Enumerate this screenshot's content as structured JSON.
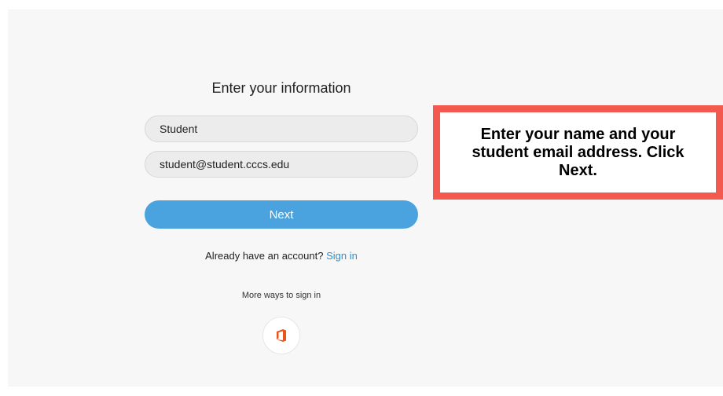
{
  "form": {
    "heading": "Enter your information",
    "name_value": "Student",
    "email_value": "student@student.cccs.edu",
    "next_label": "Next",
    "account_prompt": "Already have an account?",
    "signin_label": "Sign in",
    "more_ways_label": "More ways to sign in"
  },
  "callout": {
    "text": "Enter your name and your student email address. Click Next."
  },
  "icons": {
    "office": "office-icon"
  },
  "colors": {
    "accent": "#4aa3de",
    "link": "#2f8fd1",
    "callout_border": "#f4594f",
    "office_logo": "#e8541e"
  }
}
